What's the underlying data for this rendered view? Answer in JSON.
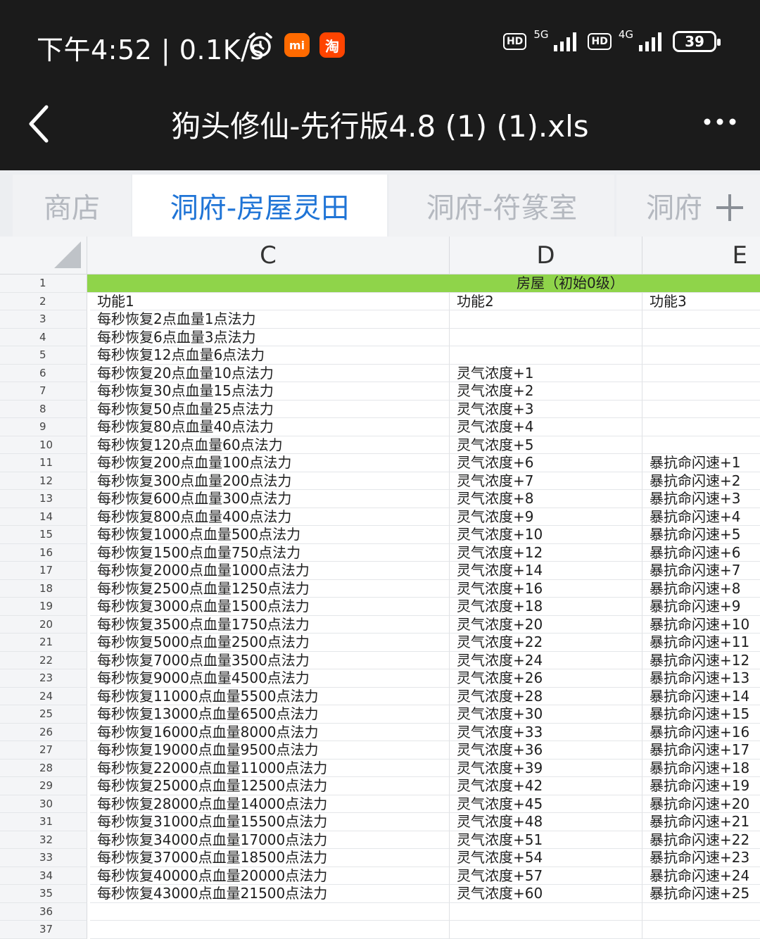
{
  "status_bar": {
    "time": "下午4:52 | 0.1K/s",
    "mi_badge": "mi",
    "taobao_badge": "淘",
    "hd1": "HD",
    "net1": "5G",
    "hd2": "HD",
    "net2": "4G",
    "battery": "39"
  },
  "header": {
    "title": "狗头修仙-先行版4.8 (1) (1).xls"
  },
  "tabs": [
    {
      "label": "商店"
    },
    {
      "label": "洞府-房屋灵田"
    },
    {
      "label": "洞府-符篆室"
    },
    {
      "label": "洞府"
    }
  ],
  "columns": [
    "C",
    "D",
    "E"
  ],
  "merged_header": "房屋（初始0级）",
  "rows": [
    {
      "num": "1"
    },
    {
      "num": "2",
      "c": "功能1",
      "d": "功能2",
      "e": "功能3"
    },
    {
      "num": "3",
      "c": "每秒恢复2点血量1点法力",
      "d": "",
      "e": ""
    },
    {
      "num": "4",
      "c": "每秒恢复6点血量3点法力",
      "d": "",
      "e": ""
    },
    {
      "num": "5",
      "c": "每秒恢复12点血量6点法力",
      "d": "",
      "e": ""
    },
    {
      "num": "6",
      "c": "每秒恢复20点血量10点法力",
      "d": "灵气浓度+1",
      "e": ""
    },
    {
      "num": "7",
      "c": "每秒恢复30点血量15点法力",
      "d": "灵气浓度+2",
      "e": ""
    },
    {
      "num": "8",
      "c": "每秒恢复50点血量25点法力",
      "d": "灵气浓度+3",
      "e": ""
    },
    {
      "num": "9",
      "c": "每秒恢复80点血量40点法力",
      "d": "灵气浓度+4",
      "e": ""
    },
    {
      "num": "10",
      "c": "每秒恢复120点血量60点法力",
      "d": "灵气浓度+5",
      "e": ""
    },
    {
      "num": "11",
      "c": "每秒恢复200点血量100点法力",
      "d": "灵气浓度+6",
      "e": "暴抗命闪速+1"
    },
    {
      "num": "12",
      "c": "每秒恢复300点血量200点法力",
      "d": "灵气浓度+7",
      "e": "暴抗命闪速+2"
    },
    {
      "num": "13",
      "c": "每秒恢复600点血量300点法力",
      "d": "灵气浓度+8",
      "e": "暴抗命闪速+3"
    },
    {
      "num": "14",
      "c": "每秒恢复800点血量400点法力",
      "d": "灵气浓度+9",
      "e": "暴抗命闪速+4"
    },
    {
      "num": "15",
      "c": "每秒恢复1000点血量500点法力",
      "d": "灵气浓度+10",
      "e": "暴抗命闪速+5"
    },
    {
      "num": "16",
      "c": "每秒恢复1500点血量750点法力",
      "d": "灵气浓度+12",
      "e": "暴抗命闪速+6"
    },
    {
      "num": "17",
      "c": "每秒恢复2000点血量1000点法力",
      "d": "灵气浓度+14",
      "e": "暴抗命闪速+7"
    },
    {
      "num": "18",
      "c": "每秒恢复2500点血量1250点法力",
      "d": "灵气浓度+16",
      "e": "暴抗命闪速+8"
    },
    {
      "num": "19",
      "c": "每秒恢复3000点血量1500点法力",
      "d": "灵气浓度+18",
      "e": "暴抗命闪速+9"
    },
    {
      "num": "20",
      "c": "每秒恢复3500点血量1750点法力",
      "d": "灵气浓度+20",
      "e": "暴抗命闪速+10"
    },
    {
      "num": "21",
      "c": "每秒恢复5000点血量2500点法力",
      "d": "灵气浓度+22",
      "e": "暴抗命闪速+11"
    },
    {
      "num": "22",
      "c": "每秒恢复7000点血量3500点法力",
      "d": "灵气浓度+24",
      "e": "暴抗命闪速+12"
    },
    {
      "num": "23",
      "c": "每秒恢复9000点血量4500点法力",
      "d": "灵气浓度+26",
      "e": "暴抗命闪速+13"
    },
    {
      "num": "24",
      "c": "每秒恢复11000点血量5500点法力",
      "d": "灵气浓度+28",
      "e": "暴抗命闪速+14"
    },
    {
      "num": "25",
      "c": "每秒恢复13000点血量6500点法力",
      "d": "灵气浓度+30",
      "e": "暴抗命闪速+15"
    },
    {
      "num": "26",
      "c": "每秒恢复16000点血量8000点法力",
      "d": "灵气浓度+33",
      "e": "暴抗命闪速+16"
    },
    {
      "num": "27",
      "c": "每秒恢复19000点血量9500点法力",
      "d": "灵气浓度+36",
      "e": "暴抗命闪速+17"
    },
    {
      "num": "28",
      "c": "每秒恢复22000点血量11000点法力",
      "d": "灵气浓度+39",
      "e": "暴抗命闪速+18"
    },
    {
      "num": "29",
      "c": "每秒恢复25000点血量12500点法力",
      "d": "灵气浓度+42",
      "e": "暴抗命闪速+19"
    },
    {
      "num": "30",
      "c": "每秒恢复28000点血量14000点法力",
      "d": "灵气浓度+45",
      "e": "暴抗命闪速+20"
    },
    {
      "num": "31",
      "c": "每秒恢复31000点血量15500点法力",
      "d": "灵气浓度+48",
      "e": "暴抗命闪速+21"
    },
    {
      "num": "32",
      "c": "每秒恢复34000点血量17000点法力",
      "d": "灵气浓度+51",
      "e": "暴抗命闪速+22"
    },
    {
      "num": "33",
      "c": "每秒恢复37000点血量18500点法力",
      "d": "灵气浓度+54",
      "e": "暴抗命闪速+23"
    },
    {
      "num": "34",
      "c": "每秒恢复40000点血量20000点法力",
      "d": "灵气浓度+57",
      "e": "暴抗命闪速+24"
    },
    {
      "num": "35",
      "c": "每秒恢复43000点血量21500点法力",
      "d": "灵气浓度+60",
      "e": "暴抗命闪速+25"
    },
    {
      "num": "36",
      "c": "",
      "d": "",
      "e": ""
    },
    {
      "num": "37",
      "c": "",
      "d": "",
      "e": ""
    }
  ],
  "colors": {
    "header_bg": "#1b1b1b",
    "active_tab": "#1f74d6",
    "merged_fill": "#8fd44a"
  }
}
